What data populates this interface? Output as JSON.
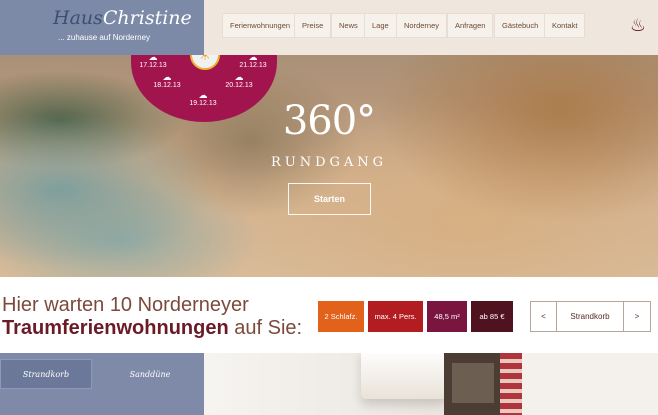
{
  "header": {
    "logo_haus": "Haus",
    "logo_name": "Christine",
    "tagline": "... zuhause auf Norderney",
    "nav": [
      "Ferienwohnungen",
      "Preise",
      "News",
      "Lage",
      "Norderney",
      "Anfragen",
      "Gästebuch",
      "Kontakt"
    ],
    "icon": "sauna-icon"
  },
  "weather": {
    "dates": [
      "17.12.13",
      "18.12.13",
      "19.12.13",
      "20.12.13",
      "21.12.13"
    ],
    "icons": [
      "cloud-rain-icon",
      "cloud-rain-icon",
      "cloud-rain-icon",
      "cloud-rain-icon",
      "cloud-icon"
    ],
    "sun_icon": "sun-icon"
  },
  "hero": {
    "title": "360°",
    "subtitle": "RUNDGANG",
    "button": "Starten"
  },
  "band": {
    "line1": "Hier warten 10 Norderneyer",
    "line2_bold": "Traumferienwohnungen",
    "line2_rest": " auf Sie:",
    "features": [
      {
        "label": "2 Schlafz.",
        "color": "#e2621c"
      },
      {
        "label": "max. 4 Pers.",
        "color": "#b31d22"
      },
      {
        "label": "48,5 m²",
        "color": "#7a1540"
      },
      {
        "label": "ab 85 €",
        "color": "#4f1320"
      }
    ],
    "pager": {
      "prev": "<",
      "label": "Strandkorb",
      "next": ">"
    }
  },
  "tabs": [
    "Strandkorb",
    "Sanddüne"
  ]
}
